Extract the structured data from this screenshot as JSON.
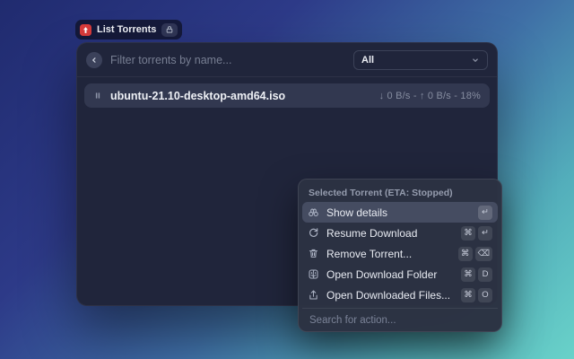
{
  "colors": {
    "background_top_left": "#202b6f",
    "background_bottom_right": "#69d2c9",
    "extension_icon_red": "#d93b3b",
    "window_bg": "#20253b",
    "panel_bg": "#2c3242",
    "selection_bg": "#454c61"
  },
  "header_chip": {
    "label": "List Torrents",
    "app_icon": "transmission-icon",
    "badge_icon": "lock-icon"
  },
  "window": {
    "back_icon": "chevron-left-icon",
    "search": {
      "placeholder": "Filter torrents by name...",
      "value": ""
    },
    "dropdown": {
      "value": "All",
      "icon": "chevron-down-icon"
    },
    "torrents": [
      {
        "status_icon": "pause-icon",
        "title": "ubuntu-21.10-desktop-amd64.iso",
        "accessory": "↓ 0 B/s - ↑ 0 B/s - 18%"
      }
    ]
  },
  "action_panel": {
    "section_title": "Selected Torrent (ETA: Stopped)",
    "items": [
      {
        "icon": "binoculars-icon",
        "label": "Show details",
        "keys": [
          "↵"
        ],
        "selected": true
      },
      {
        "icon": "refresh-icon",
        "label": "Resume Download",
        "keys": [
          "⌘",
          "↵"
        ]
      },
      {
        "icon": "trash-icon",
        "label": "Remove Torrent...",
        "keys": [
          "⌘",
          "⌫"
        ]
      },
      {
        "icon": "finder-icon",
        "label": "Open Download Folder",
        "keys": [
          "⌘",
          "D"
        ]
      },
      {
        "icon": "upload-icon",
        "label": "Open Downloaded Files...",
        "keys": [
          "⌘",
          "O"
        ]
      }
    ],
    "search": {
      "placeholder": "Search for action...",
      "value": ""
    }
  }
}
